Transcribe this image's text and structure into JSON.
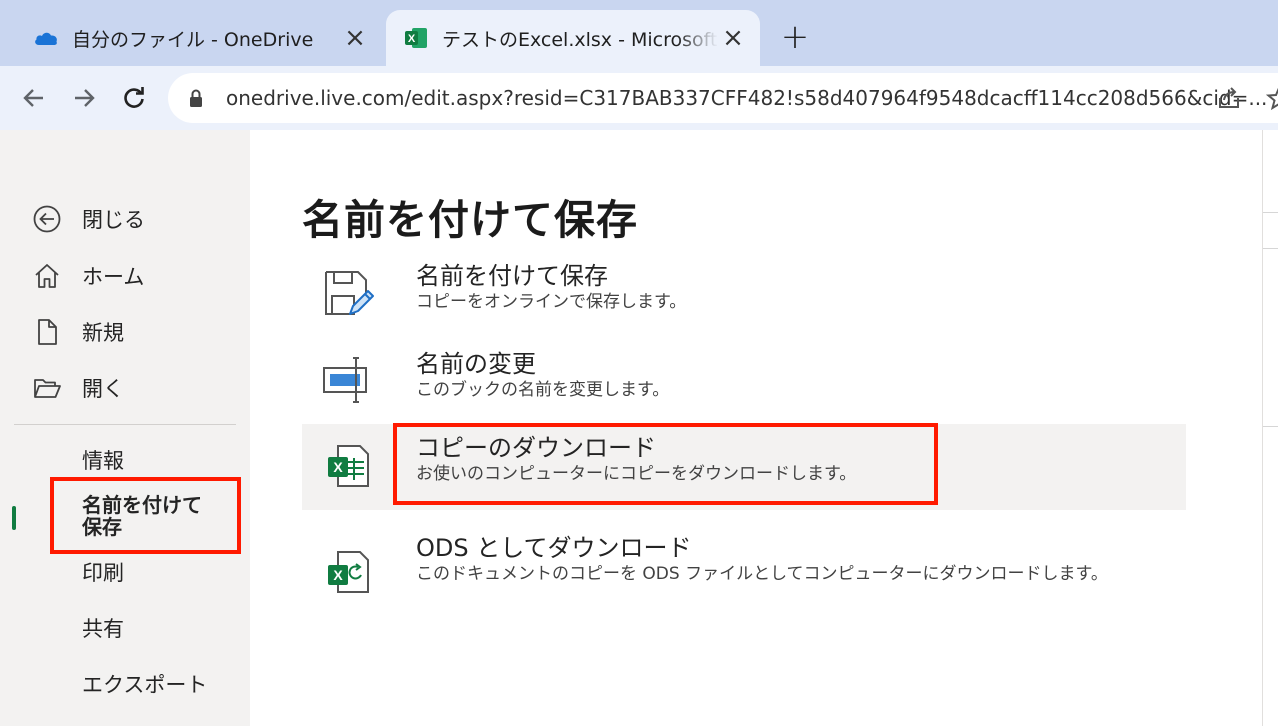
{
  "browser": {
    "tabs": [
      {
        "title": "自分のファイル - OneDrive",
        "favicon": "onedrive-cloud-icon",
        "active": false
      },
      {
        "title": "テストのExcel.xlsx - Microsoft Excel",
        "favicon": "excel-icon",
        "active": true
      }
    ],
    "new_tab": "+",
    "url": "onedrive.live.com/edit.aspx?resid=C317BAB337CFF482!s58d407964f9548dcacff114cc208d566&cid=..."
  },
  "sidebar": {
    "nav": [
      {
        "label": "閉じる",
        "icon": "back-arrow-circle-icon"
      },
      {
        "label": "ホーム",
        "icon": "home-icon"
      },
      {
        "label": "新規",
        "icon": "new-document-icon"
      },
      {
        "label": "開く",
        "icon": "open-folder-icon"
      }
    ],
    "sub": [
      {
        "label": "情報"
      },
      {
        "label": "名前を付けて\n保存",
        "selected": true
      },
      {
        "label": "印刷"
      },
      {
        "label": "共有"
      },
      {
        "label": "エクスポート"
      }
    ]
  },
  "main": {
    "title": "名前を付けて保存",
    "options": [
      {
        "title": "名前を付けて保存",
        "desc": "コピーをオンラインで保存します。",
        "icon": "save-as-icon"
      },
      {
        "title": "名前の変更",
        "desc": "このブックの名前を変更します。",
        "icon": "rename-icon"
      },
      {
        "title": "コピーのダウンロード",
        "desc": "お使いのコンピューターにコピーをダウンロードします。",
        "icon": "excel-download-icon",
        "highlighted": true
      },
      {
        "title": "ODS としてダウンロード",
        "desc": "このドキュメントのコピーを ODS ファイルとしてコンピューターにダウンロードします。",
        "icon": "ods-download-icon"
      }
    ]
  },
  "colors": {
    "excel_green": "#107c41",
    "highlight_red": "#ff1a00",
    "tabstrip": "#c9d6f0",
    "toolbar": "#ecf1fb",
    "sidebar_bg": "#f3f2f1"
  }
}
